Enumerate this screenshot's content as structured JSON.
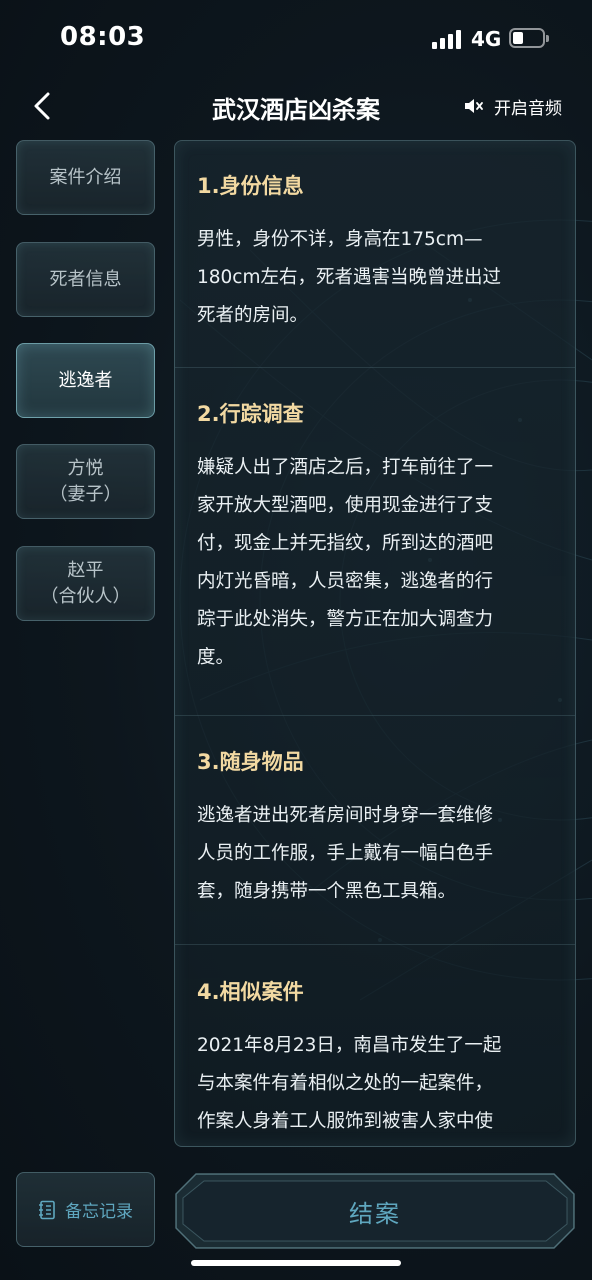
{
  "status_bar": {
    "time": "08:03",
    "network": "4G",
    "battery_percent": 25
  },
  "header": {
    "title": "武汉酒店凶杀案",
    "audio_label": "开启音频"
  },
  "sidebar": {
    "items": [
      {
        "line1": "案件介绍",
        "line2": "",
        "active": false
      },
      {
        "line1": "死者信息",
        "line2": "",
        "active": false
      },
      {
        "line1": "逃逸者",
        "line2": "",
        "active": true
      },
      {
        "line1": "方悦",
        "line2": "（妻子）",
        "active": false
      },
      {
        "line1": "赵平",
        "line2": "（合伙人）",
        "active": false
      }
    ]
  },
  "content": {
    "sections": [
      {
        "title": "1.身份信息",
        "lines": [
          "男性，身份不详，身高在175cm—",
          "180cm左右，死者遇害当晚曾进出过",
          "死者的房间。"
        ]
      },
      {
        "title": "2.行踪调查",
        "lines": [
          "嫌疑人出了酒店之后，打车前往了一",
          "家开放大型酒吧，使用现金进行了支",
          "付，现金上并无指纹，所到达的酒吧",
          "内灯光昏暗，人员密集，逃逸者的行",
          "踪于此处消失，警方正在加大调查力",
          "度。"
        ]
      },
      {
        "title": "3.随身物品",
        "lines": [
          "逃逸者进出死者房间时身穿一套维修",
          "人员的工作服，手上戴有一幅白色手",
          "套，随身携带一个黑色工具箱。"
        ]
      },
      {
        "title": "4.相似案件",
        "lines": [
          "2021年8月23日，南昌市发生了一起",
          "与本案件有着相似之处的一起案件，",
          "作案人身着工人服饰到被害人家中使"
        ]
      }
    ]
  },
  "footer": {
    "memo_label": "备忘记录",
    "close_case_label": "结案"
  },
  "icons": {
    "back": "chevron-left-icon",
    "audio": "speaker-muted-icon",
    "memo": "notebook-icon"
  },
  "colors": {
    "accent": "#5fa7bf",
    "section_title": "#f2d9a2",
    "background": "#0c141b"
  }
}
